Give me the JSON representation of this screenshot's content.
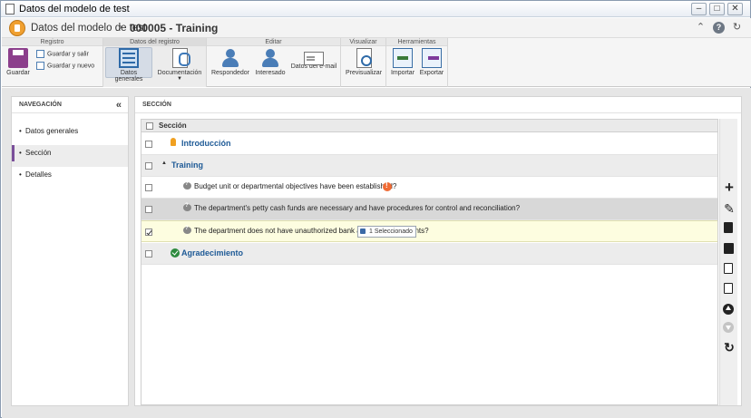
{
  "window": {
    "title": "Datos del modelo de test",
    "buttons": [
      "⌃",
      "?",
      "↻"
    ]
  },
  "header": {
    "model_title": "Datos del modelo de test",
    "separator": "›",
    "record": "000005 - Training"
  },
  "ribbon": {
    "groups": [
      {
        "label": "Registro"
      },
      {
        "label": "Datos del registro"
      },
      {
        "label": "Editar"
      },
      {
        "label": "Visualizar"
      },
      {
        "label": "Herramientas"
      }
    ],
    "save": "Guardar",
    "save_exit": "Guardar y salir",
    "save_new": "Guardar y nuevo",
    "general_data": "Datos generales",
    "documentation": "Documentación",
    "respondent": "Respondedor",
    "interested": "Interesado",
    "email_data": "Datos del e-mail",
    "preview": "Previsualizar",
    "import": "Importar",
    "export": "Exportar"
  },
  "nav": {
    "title": "NAVEGACIÓN",
    "collapse": "«",
    "items": [
      {
        "label": "Datos generales"
      },
      {
        "label": "Sección"
      },
      {
        "label": "Detalles"
      }
    ],
    "selected": "Sección"
  },
  "section": {
    "title": "SECCIÓN",
    "column": "Sección",
    "rows": [
      {
        "text": "Introducción",
        "kind": "heading",
        "icon": "bulb-icon"
      },
      {
        "text": "Training",
        "kind": "group"
      },
      {
        "text": "Budget unit or departmental objectives have been established?",
        "kind": "question",
        "flag": "warning"
      },
      {
        "text": "The department's petty cash funds are necessary and have procedures for control and reconciliation?",
        "kind": "question"
      },
      {
        "text": "The department does not have unauthorized bank accou",
        "text_end": "unts?",
        "kind": "question",
        "checked": true
      },
      {
        "text": "Agradecimiento",
        "kind": "heading",
        "icon": "check-icon"
      }
    ],
    "tooltip": "1 Seleccionado"
  },
  "toolbar": {
    "add": "+",
    "edit": "✎",
    "delete": "🗑",
    "refresh": "↻"
  },
  "colors": {
    "accent": "#1e5a96",
    "selected_nav": "#7a4f9a",
    "checked_row": "#fdfde0",
    "warning": "#ef6b35"
  }
}
